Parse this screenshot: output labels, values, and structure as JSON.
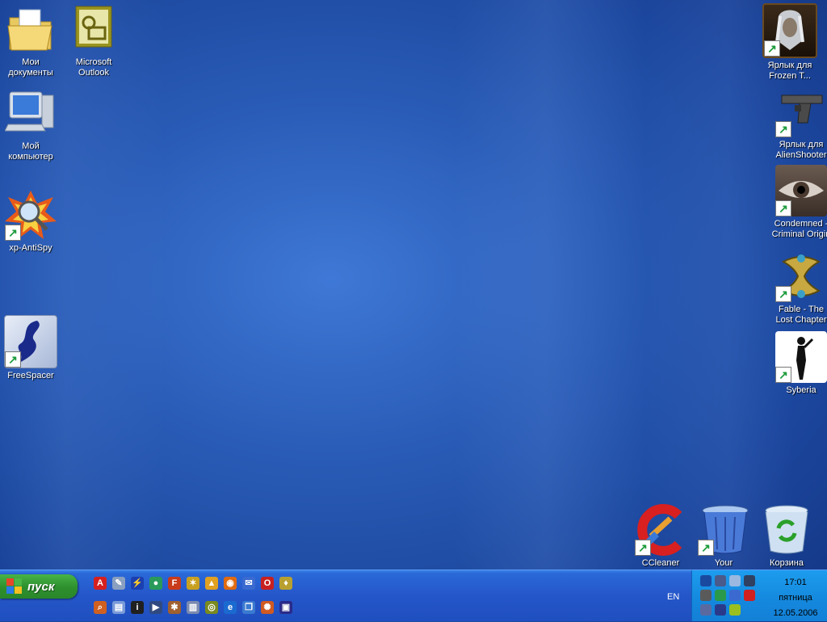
{
  "desktop": {
    "icons_left": [
      {
        "label": "Мои\nдокументы",
        "icon": "folder-documents-icon",
        "shortcut": false
      },
      {
        "label": "Microsoft\nOutlook",
        "icon": "outlook-icon",
        "shortcut": false
      },
      {
        "label": "Мой\nкомпьютер",
        "icon": "computer-icon",
        "shortcut": false
      },
      {
        "label": "xp-AntiSpy",
        "icon": "magnifier-icon",
        "shortcut": true
      },
      {
        "label": "FreeSpacer",
        "icon": "freespacer-icon",
        "shortcut": true
      }
    ],
    "icons_right": [
      {
        "label": "Ярлык для\nFrozen T...",
        "icon": "frozen-throne-icon",
        "shortcut": true
      },
      {
        "label": "Ярлык для\nAlienShooter",
        "icon": "pistol-icon",
        "shortcut": true
      },
      {
        "label": "Condemned -\nCriminal Origin",
        "icon": "eye-icon",
        "shortcut": true
      },
      {
        "label": "Fable - The\nLost Chapter",
        "icon": "fable-icon",
        "shortcut": true
      },
      {
        "label": "Syberia",
        "icon": "syberia-icon",
        "shortcut": true
      },
      {
        "label": "CCleaner",
        "icon": "ccleaner-icon",
        "shortcut": true
      },
      {
        "label": "Your",
        "icon": "recycle-bin-icon",
        "shortcut": true
      },
      {
        "label": "Корзина",
        "icon": "recycle-bin-full-icon",
        "shortcut": false
      }
    ]
  },
  "taskbar": {
    "start_label": "пуск",
    "quick_launch": [
      {
        "icon": "acrobat-icon",
        "color": "#d62020",
        "glyph": "A"
      },
      {
        "icon": "tools-icon",
        "color": "#8aa0c0",
        "glyph": "✎"
      },
      {
        "icon": "winamp-icon",
        "color": "#1a3fb0",
        "glyph": "⚡"
      },
      {
        "icon": "globe-icon",
        "color": "#2a9a5a",
        "glyph": "●"
      },
      {
        "icon": "filezilla-icon",
        "color": "#c83a1a",
        "glyph": "F"
      },
      {
        "icon": "network-icon",
        "color": "#c8a020",
        "glyph": "✶"
      },
      {
        "icon": "daemon-tools-icon",
        "color": "#e0a020",
        "glyph": "▲"
      },
      {
        "icon": "firefox-icon",
        "color": "#e06a10",
        "glyph": "◉"
      },
      {
        "icon": "mail-icon",
        "color": "#3a6ad0",
        "glyph": "✉"
      },
      {
        "icon": "opera-icon",
        "color": "#c82020",
        "glyph": "O"
      },
      {
        "icon": "utility-icon",
        "color": "#b8a030",
        "glyph": "♦"
      },
      {
        "icon": "search-icon",
        "color": "#d06020",
        "glyph": "⌕"
      },
      {
        "icon": "explorer-icon",
        "color": "#7a9ad8",
        "glyph": "▤"
      },
      {
        "icon": "info-icon",
        "color": "#202020",
        "glyph": "i"
      },
      {
        "icon": "media-player-icon",
        "color": "#304a80",
        "glyph": "▶"
      },
      {
        "icon": "bug-icon",
        "color": "#a06030",
        "glyph": "✱"
      },
      {
        "icon": "trash-icon",
        "color": "#7a8ab0",
        "glyph": "▥"
      },
      {
        "icon": "winrar-icon",
        "color": "#7a8a20",
        "glyph": "◎"
      },
      {
        "icon": "ie-icon",
        "color": "#1a6ad0",
        "glyph": "e"
      },
      {
        "icon": "copy-icon",
        "color": "#3a7ad0",
        "glyph": "❐"
      },
      {
        "icon": "settings-icon",
        "color": "#d05a20",
        "glyph": "✺"
      },
      {
        "icon": "save-icon",
        "color": "#2a2a8a",
        "glyph": "▣"
      }
    ],
    "language": "EN",
    "tray_icons": [
      {
        "icon": "tray-gear-icon",
        "color": "#1a4aa0"
      },
      {
        "icon": "tray-wrench-icon",
        "color": "#4a5a8a"
      },
      {
        "icon": "tray-window-icon",
        "color": "#9ab8e0"
      },
      {
        "icon": "tray-display-icon",
        "color": "#304060"
      },
      {
        "icon": "tray-alarm-icon",
        "color": "#5a5a5a"
      },
      {
        "icon": "tray-globe-icon",
        "color": "#2a9a4a"
      },
      {
        "icon": "tray-volume-icon",
        "color": "#3a6ad0"
      },
      {
        "icon": "tray-warning-icon",
        "color": "#d02020"
      },
      {
        "icon": "tray-network-icon",
        "color": "#5a6aa0"
      },
      {
        "icon": "tray-antivirus-icon",
        "color": "#2a3a8a"
      },
      {
        "icon": "tray-nvidia-icon",
        "color": "#9ac020"
      }
    ],
    "clock": {
      "time": "17:01",
      "day": "пятница",
      "date": "12.05.2006"
    }
  }
}
